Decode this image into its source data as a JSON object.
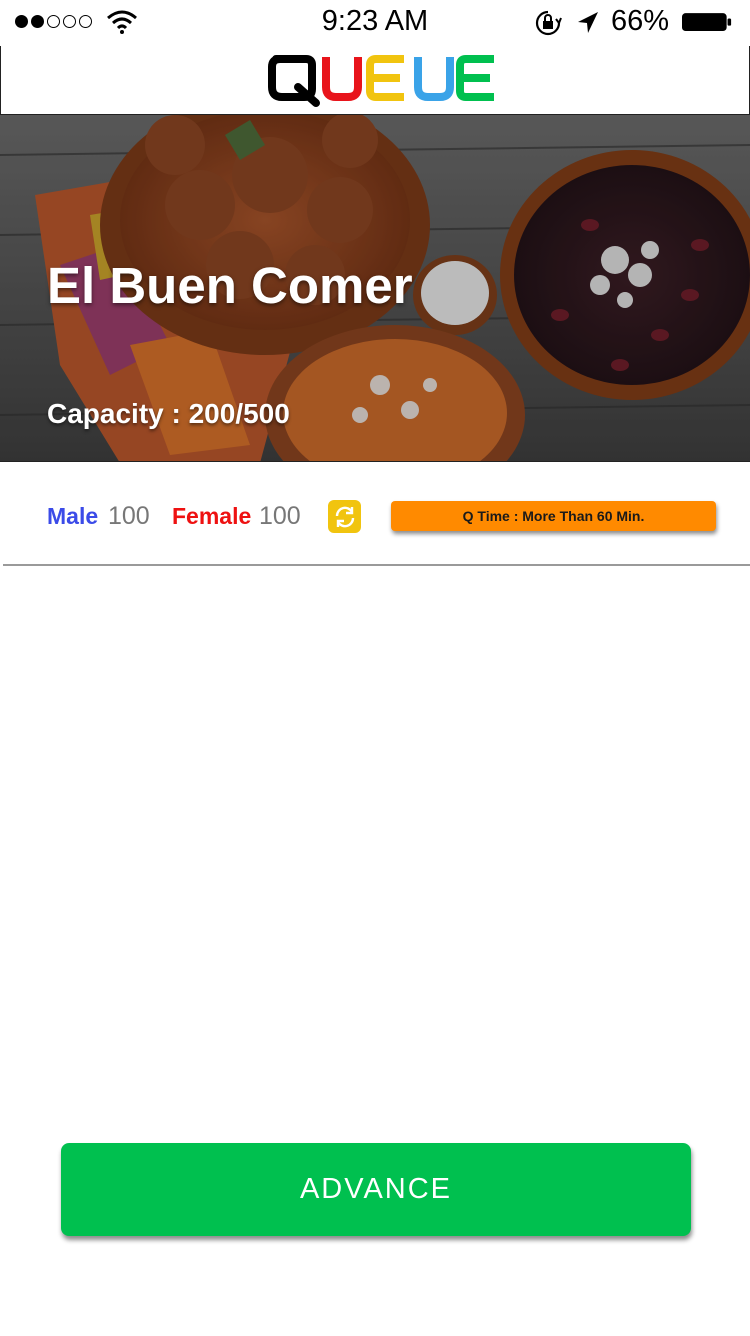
{
  "status_bar": {
    "time": "9:23 AM",
    "battery_percent": "66%",
    "signal_strength": 2,
    "signal_max": 5,
    "icons": [
      "wifi-icon",
      "rotation-lock-icon",
      "location-arrow-icon",
      "battery-icon"
    ]
  },
  "header": {
    "logo_letters": [
      "Q",
      "U",
      "E",
      "U",
      "E"
    ],
    "logo_colors": [
      "#000000",
      "#e8141b",
      "#f1c40f",
      "#3aa3e8",
      "#00c04f"
    ]
  },
  "restaurant": {
    "name": "El Buen Comer",
    "capacity_text": "Capacity : 200/500"
  },
  "stats": {
    "male_label": "Male",
    "male_count": "100",
    "female_label": "Female",
    "female_count": "100",
    "refresh_icon": "refresh-icon",
    "qtime_text": "Q Time : More Than 60 Min."
  },
  "actions": {
    "advance_label": "ADVANCE"
  },
  "colors": {
    "male": "#3b4be8",
    "female": "#ee1111",
    "refresh": "#f1c40f",
    "qtime": "#ff8a00",
    "advance": "#00c04f"
  }
}
